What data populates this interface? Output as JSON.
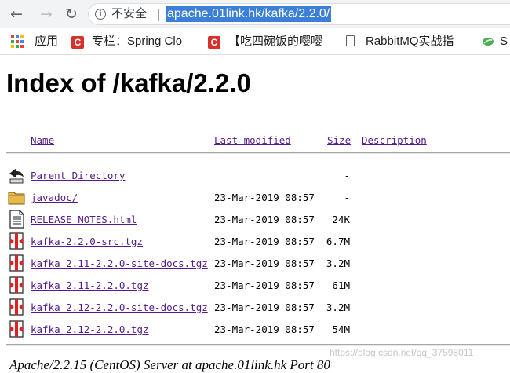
{
  "browser": {
    "back_glyph": "←",
    "forward_glyph": "→",
    "reload_glyph": "↻",
    "info_glyph": "i",
    "security_label": "不安全",
    "url": "apache.01link.hk/kafka/2.2.0/"
  },
  "bookmarks": {
    "apps_label": "应用",
    "items": [
      {
        "label": "专栏：Spring Clo",
        "icon": "csdn-c-icon"
      },
      {
        "label": "【吃四碗饭的嘤嘤",
        "icon": "csdn-c-icon"
      },
      {
        "label": "RabbitMQ实战指",
        "icon": "document-icon"
      },
      {
        "label": "S",
        "icon": "leaf-icon"
      }
    ],
    "csdn_glyph": "C"
  },
  "page": {
    "title": "Index of /kafka/2.2.0",
    "columns": {
      "name": "Name",
      "modified": "Last modified",
      "size": "Size",
      "description": "Description"
    },
    "rows": [
      {
        "name": "Parent Directory",
        "modified": "",
        "size": "-",
        "icon": "back-arrow-icon"
      },
      {
        "name": "javadoc/",
        "modified": "23-Mar-2019 08:57",
        "size": "-",
        "icon": "folder-icon"
      },
      {
        "name": "RELEASE_NOTES.html",
        "modified": "23-Mar-2019 08:57",
        "size": "24K",
        "icon": "text-file-icon"
      },
      {
        "name": "kafka-2.2.0-src.tgz",
        "modified": "23-Mar-2019 08:57",
        "size": "6.7M",
        "icon": "archive-icon"
      },
      {
        "name": "kafka_2.11-2.2.0-site-docs.tgz",
        "modified": "23-Mar-2019 08:57",
        "size": "3.2M",
        "icon": "archive-icon"
      },
      {
        "name": "kafka_2.11-2.2.0.tgz",
        "modified": "23-Mar-2019 08:57",
        "size": "61M",
        "icon": "archive-icon"
      },
      {
        "name": "kafka_2.12-2.2.0-site-docs.tgz",
        "modified": "23-Mar-2019 08:57",
        "size": "3.2M",
        "icon": "archive-icon"
      },
      {
        "name": "kafka_2.12-2.2.0.tgz",
        "modified": "23-Mar-2019 08:57",
        "size": "54M",
        "icon": "archive-icon"
      }
    ],
    "footer": "Apache/2.2.15 (CentOS) Server at apache.01link.hk Port 80",
    "watermark": "https://blog.csdn.net/qq_37598011"
  },
  "colors": {
    "link": "#551a8b",
    "url_highlight": "#3b7fd6",
    "csdn_red": "#d9302c"
  }
}
